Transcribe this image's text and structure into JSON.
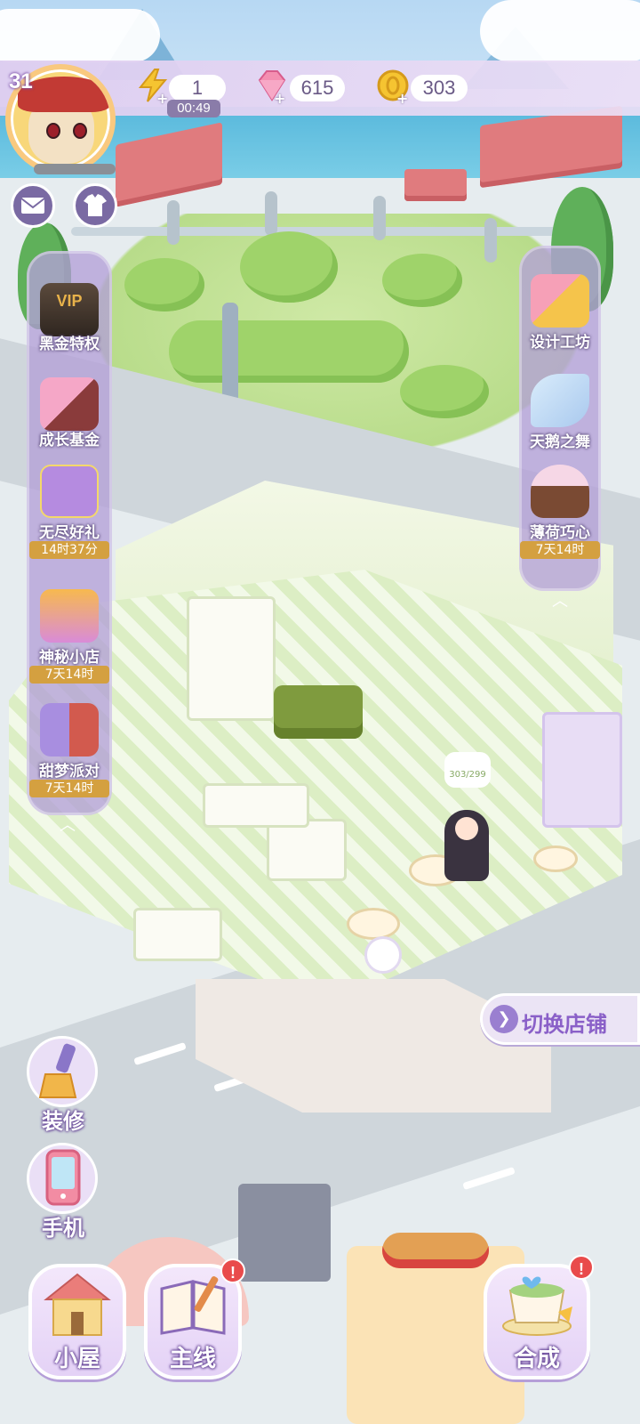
{
  "player": {
    "level": "31"
  },
  "resources": {
    "energy": {
      "value": "1",
      "timer": "00:49",
      "icon": "lightning-icon"
    },
    "gems": {
      "value": "615",
      "icon": "diamond-icon"
    },
    "coins": {
      "value": "303",
      "icon": "coin-icon"
    }
  },
  "top_buttons": {
    "mail_icon": "mail-icon",
    "wardrobe_icon": "shirt-icon"
  },
  "left_panel": {
    "items": [
      {
        "label": "黑金特权",
        "badge_text": "VIP",
        "icon": "vip-card-icon"
      },
      {
        "label": "成长基金",
        "icon": "gift-boxes-icon"
      },
      {
        "label": "无尽好礼",
        "time": "14时37分",
        "icon": "cat-gift-icon"
      },
      {
        "label": "神秘小店",
        "time": "7天14时",
        "icon": "mystery-box-icon"
      },
      {
        "label": "甜梦派对",
        "time": "7天14时",
        "icon": "cards-icon"
      }
    ]
  },
  "right_panel": {
    "items": [
      {
        "label": "设计工坊",
        "icon": "ruler-pencil-icon"
      },
      {
        "label": "天鹅之舞",
        "icon": "feather-icon"
      },
      {
        "label": "薄荷巧心",
        "time": "7天14时",
        "icon": "cake-icon"
      }
    ]
  },
  "shop": {
    "counter_text": "303/299",
    "switch_label": "切换店铺"
  },
  "tools": [
    {
      "label": "装修",
      "icon": "brush-icon"
    },
    {
      "label": "手机",
      "icon": "phone-icon"
    }
  ],
  "nav": [
    {
      "label": "小屋",
      "icon": "house-icon"
    },
    {
      "label": "主线",
      "icon": "book-icon",
      "badge": "!"
    },
    {
      "label": "合成",
      "icon": "teacup-icon",
      "badge": "!"
    }
  ],
  "colors": {
    "panel": "#b4a0d7",
    "accent": "#8a60c8",
    "timer": "#d4a040",
    "badge": "#e94b4b"
  }
}
